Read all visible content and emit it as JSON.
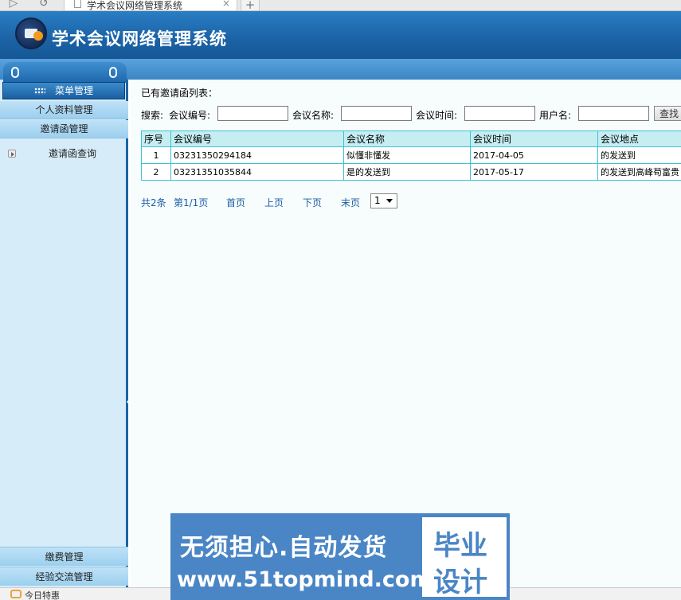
{
  "browser": {
    "tab_title": "学术会议网络管理系统",
    "back_glyph": "▷",
    "new_tab_glyph": "+",
    "close_glyph": "×"
  },
  "header": {
    "title": "学术会议网络管理系统"
  },
  "sidebar": {
    "menu_header": "菜单管理",
    "sections": [
      "个人资料管理",
      "邀请函管理"
    ],
    "sub_items": [
      "邀请函查询"
    ],
    "bottom_sections": [
      "缴费管理",
      "经验交流管理"
    ]
  },
  "content": {
    "list_title": "已有邀请函列表：",
    "search": {
      "label": "搜索:",
      "field1_label": "会议编号:",
      "field1_value": "",
      "field2_label": "会议名称:",
      "field2_value": "",
      "field3_label": "会议时间:",
      "field3_value": "",
      "field4_label": "用户名:",
      "field4_value": "",
      "button": "查找"
    },
    "table": {
      "headers": [
        "序号",
        "会议编号",
        "会议名称",
        "会议时间",
        "会议地点"
      ],
      "rows": [
        [
          "1",
          "03231350294184",
          "似懂非懂发",
          "2017-04-05",
          "的发送到"
        ],
        [
          "2",
          "03231351035844",
          "是的发送到",
          "2017-05-17",
          "的发送到高峰苟富贵"
        ]
      ]
    },
    "pager": {
      "total": "共2条",
      "page_info": "第1/1页",
      "first": "首页",
      "prev": "上页",
      "next": "下页",
      "last": "末页",
      "current": "1"
    }
  },
  "status": {
    "text": "今日特惠"
  },
  "watermark": {
    "line1": "无须担心.自动发货",
    "line2": "www.51topmind.com",
    "right1": "毕业",
    "right2": "设计"
  },
  "colors": {
    "header_blue": "#1c64a7",
    "sidebar_bg": "#d6ecf9",
    "table_border": "#3ec1d3",
    "table_header": "#c6eef2",
    "link_blue": "#1a5fa3"
  }
}
